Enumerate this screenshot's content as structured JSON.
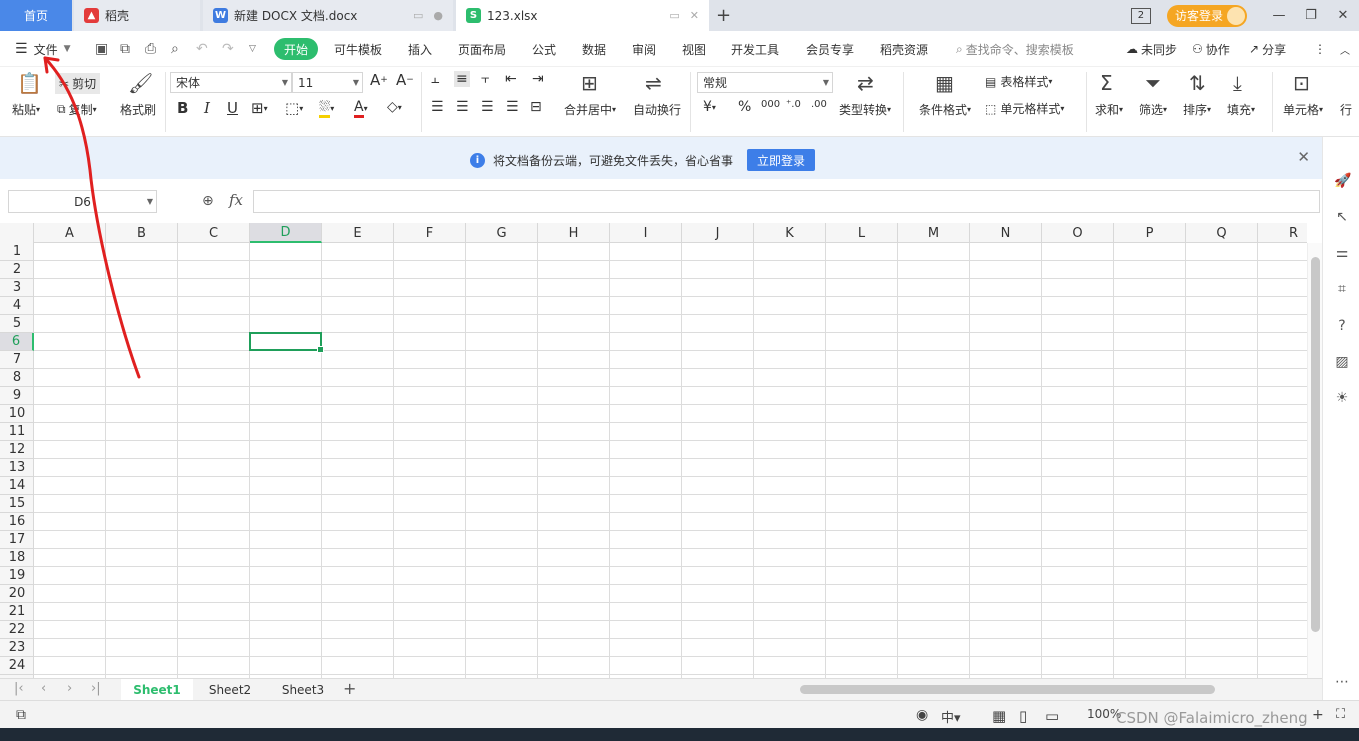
{
  "tabs": {
    "home": "首页",
    "daoke": "稻壳",
    "docx": "新建 DOCX 文档.docx",
    "xlsx": "123.xlsx"
  },
  "titlebar": {
    "window_count": "2",
    "login": "访客登录"
  },
  "menu": {
    "file": "文件",
    "items": [
      "开始",
      "可牛模板",
      "插入",
      "页面布局",
      "公式",
      "数据",
      "审阅",
      "视图",
      "开发工具",
      "会员专享",
      "稻壳资源"
    ],
    "search": "查找命令、搜索模板",
    "sync": "未同步",
    "collab": "协作",
    "share": "分享"
  },
  "ribbon": {
    "paste": "粘贴",
    "cut": "剪切",
    "copy": "复制",
    "format_painter": "格式刷",
    "font_name": "宋体",
    "font_size": "11",
    "merge": "合并居中",
    "wrap": "自动换行",
    "number_format": "常规",
    "type_convert": "类型转换",
    "cond_format": "条件格式",
    "table_style": "表格样式",
    "cell_style": "单元格样式",
    "sum": "求和",
    "filter": "筛选",
    "sort": "排序",
    "fill": "填充",
    "cell": "单元格",
    "row_col": "行"
  },
  "notice": {
    "message": "将文档备份云端，可避免文件丢失，省心省事",
    "button": "立即登录"
  },
  "formula": {
    "namebox": "D6",
    "fx": "fx"
  },
  "grid": {
    "columns": [
      "A",
      "B",
      "C",
      "D",
      "E",
      "F",
      "G",
      "H",
      "I",
      "J",
      "K",
      "L",
      "M",
      "N",
      "O",
      "P",
      "Q",
      "R"
    ],
    "rows": [
      "1",
      "2",
      "3",
      "4",
      "5",
      "6",
      "7",
      "8",
      "9",
      "10",
      "11",
      "12",
      "13",
      "14",
      "15",
      "16",
      "17",
      "18",
      "19",
      "20",
      "21",
      "22",
      "23",
      "24"
    ],
    "selected_col": "D",
    "selected_row": "6"
  },
  "sheets": [
    "Sheet1",
    "Sheet2",
    "Sheet3"
  ],
  "status": {
    "zoom": "100%"
  },
  "watermark": "CSDN @Falaimicro_zheng",
  "colors": {
    "accent_green": "#2dbd6e",
    "home_tab_blue": "#4a88e8",
    "annotation_red": "#e02020"
  }
}
